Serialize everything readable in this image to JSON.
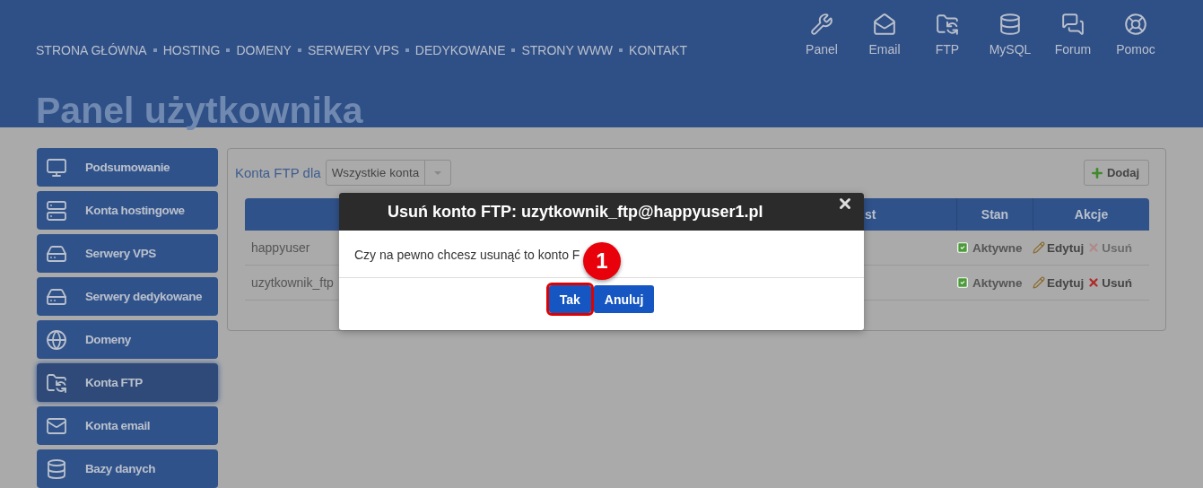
{
  "nav": {
    "links": [
      "STRONA GŁÓWNA",
      "HOSTING",
      "DOMENY",
      "SERWERY VPS",
      "DEDYKOWANE",
      "STRONY WWW",
      "KONTAKT"
    ],
    "shortcuts": [
      {
        "kind": "panel",
        "label": "Panel"
      },
      {
        "kind": "email",
        "label": "Email"
      },
      {
        "kind": "ftp",
        "label": "FTP"
      },
      {
        "kind": "mysql",
        "label": "MySQL"
      },
      {
        "kind": "forum",
        "label": "Forum"
      },
      {
        "kind": "help",
        "label": "Pomoc"
      }
    ]
  },
  "page_title": "Panel użytkownika",
  "sidebar": {
    "items": [
      {
        "kind": "summary",
        "label": "Podsumowanie",
        "selected": false
      },
      {
        "kind": "hosting",
        "label": "Konta hostingowe",
        "selected": false
      },
      {
        "kind": "vps",
        "label": "Serwery VPS",
        "selected": false
      },
      {
        "kind": "dedicated",
        "label": "Serwery dedykowane",
        "selected": false
      },
      {
        "kind": "domains",
        "label": "Domeny",
        "selected": false
      },
      {
        "kind": "ftp",
        "label": "Konta FTP",
        "selected": true
      },
      {
        "kind": "email",
        "label": "Konta email",
        "selected": false
      },
      {
        "kind": "database",
        "label": "Bazy danych",
        "selected": false
      }
    ]
  },
  "panel": {
    "filter_label": "Konta FTP dla",
    "filter_value": "Wszystkie konta",
    "add_button": "Dodaj",
    "table": {
      "columns": [
        "st",
        "Stan",
        "Akcje"
      ],
      "rows": [
        {
          "name": "happyuser",
          "status": "Aktywne",
          "edit": "Edytuj",
          "delete": "Usuń",
          "delete_disabled": true
        },
        {
          "name": "uzytkownik_ftp",
          "status": "Aktywne",
          "edit": "Edytuj",
          "delete": "Usuń",
          "delete_disabled": false
        }
      ]
    }
  },
  "dialog": {
    "title": "Usuń konto FTP: uzytkownik_ftp@happyuser1.pl",
    "message": "Czy na pewno chcesz usunąć to konto F",
    "buttons": [
      {
        "label": "Tak",
        "highlighted": true
      },
      {
        "label": "Anuluj",
        "highlighted": false
      }
    ],
    "step_badge": "1"
  }
}
